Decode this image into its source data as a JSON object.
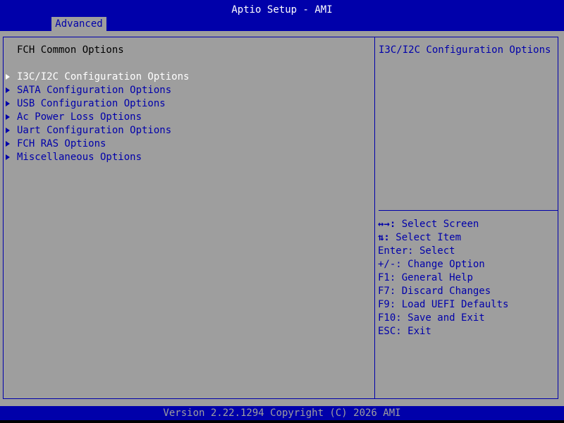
{
  "header": {
    "title": "Aptio Setup - AMI",
    "active_tab": "Advanced"
  },
  "main": {
    "section_title": "FCH Common Options",
    "menu_items": [
      {
        "label": "I3C/I2C Configuration Options",
        "selected": true
      },
      {
        "label": "SATA Configuration Options",
        "selected": false
      },
      {
        "label": "USB Configuration Options",
        "selected": false
      },
      {
        "label": "Ac Power Loss Options",
        "selected": false
      },
      {
        "label": "Uart Configuration Options",
        "selected": false
      },
      {
        "label": "FCH RAS Options",
        "selected": false
      },
      {
        "label": "Miscellaneous Options",
        "selected": false
      }
    ]
  },
  "help": {
    "text": "I3C/I2C Configuration Options"
  },
  "keys": [
    {
      "key": "↔→:",
      "action": " Select Screen"
    },
    {
      "key": "⇅:",
      "action": " Select Item"
    },
    {
      "key": "Enter:",
      "action": " Select"
    },
    {
      "key": "+/-:",
      "action": " Change Option"
    },
    {
      "key": "F1:",
      "action": " General Help"
    },
    {
      "key": "F7:",
      "action": " Discard Changes"
    },
    {
      "key": "F9:",
      "action": " Load UEFI Defaults"
    },
    {
      "key": "F10:",
      "action": " Save and Exit"
    },
    {
      "key": "ESC:",
      "action": " Exit"
    }
  ],
  "footer": {
    "version": "Version 2.22.1294 Copyright (C) 2026 AMI"
  },
  "colors": {
    "background": "#9e9e9e",
    "bar": "#0000aa",
    "text_highlight": "#ffffff",
    "text_normal": "#0000aa"
  }
}
